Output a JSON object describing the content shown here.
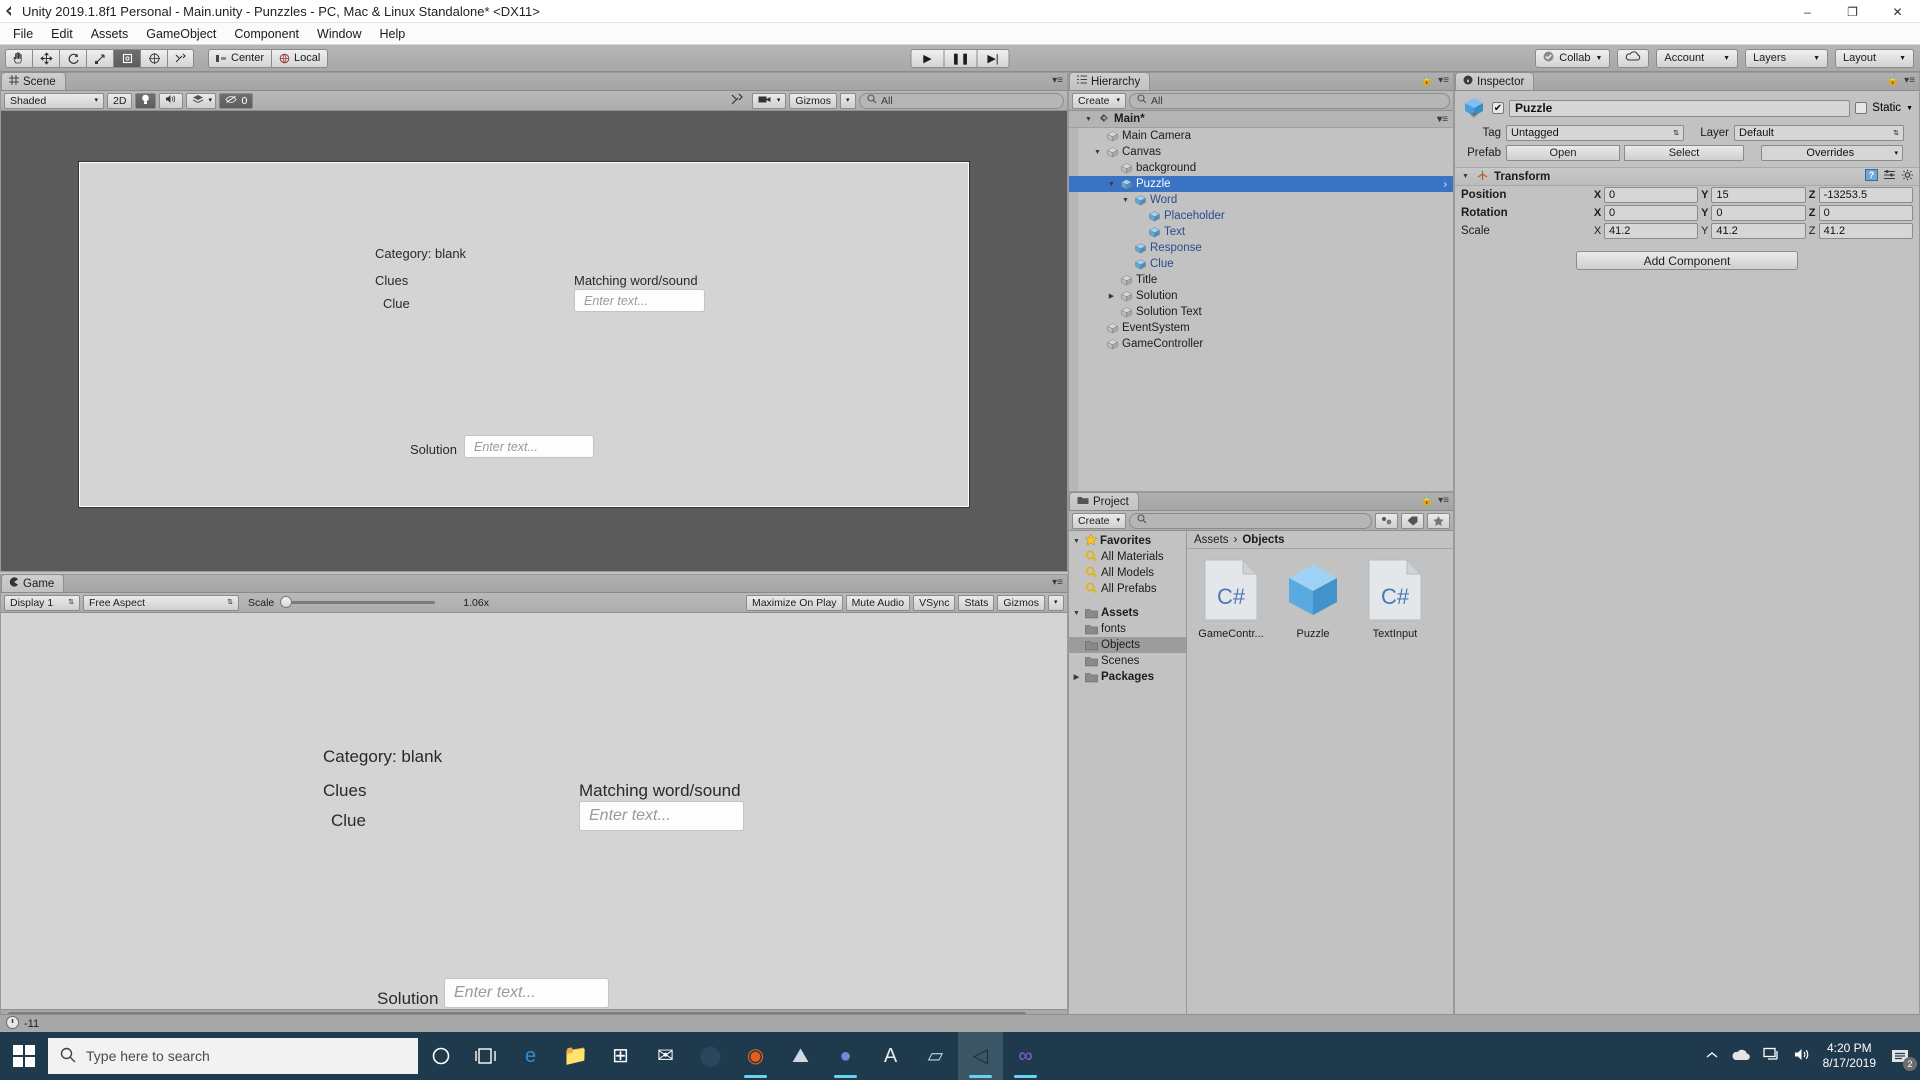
{
  "window": {
    "title": "Unity 2019.1.8f1 Personal - Main.unity - Punzzles - PC, Mac & Linux Standalone* <DX11>",
    "minimize": "–",
    "maximize": "❐",
    "close": "✕"
  },
  "menu": [
    "File",
    "Edit",
    "Assets",
    "GameObject",
    "Component",
    "Window",
    "Help"
  ],
  "toolbar": {
    "tools": [
      "hand-tool",
      "move-tool",
      "rotate-tool",
      "scale-tool",
      "rect-tool",
      "transform-tool",
      "custom-tool"
    ],
    "active_tool_index": 4,
    "pivot_label": "Center",
    "space_label": "Local",
    "play": "▶",
    "pause": "❚❚",
    "step": "▶|",
    "collab_label": "Collab",
    "account_label": "Account",
    "layers_label": "Layers",
    "layout_label": "Layout"
  },
  "scene": {
    "tab_label": "Scene",
    "draw_mode": "Shaded",
    "mode_2d": "2D",
    "lighting_icon": "light-bulb-icon",
    "audio_icon": "speaker-icon",
    "fx_icon": "effects-icon",
    "hidden_count": "0",
    "gizmos_label": "Gizmos",
    "search_placeholder": "All",
    "camera_icon": "camera-icon",
    "tools_icon": "tools-icon"
  },
  "game": {
    "tab_label": "Game",
    "display": "Display 1",
    "aspect": "Free Aspect",
    "scale_label": "Scale",
    "scale_value": "1.06x",
    "maximize_label": "Maximize On Play",
    "mute_label": "Mute Audio",
    "vsync_label": "VSync",
    "stats_label": "Stats",
    "gizmos_label": "Gizmos"
  },
  "puzzle_ui": {
    "category": "Category: blank",
    "clues_header": "Clues",
    "matching_header": "Matching word/sound",
    "clue_label": "Clue",
    "clue_placeholder": "Enter text...",
    "solution_label": "Solution",
    "solution_placeholder": "Enter text..."
  },
  "hierarchy": {
    "tab_label": "Hierarchy",
    "create_label": "Create",
    "search_placeholder": "All",
    "scene_name": "Main*",
    "items": [
      {
        "label": "Main Camera",
        "depth": 1,
        "twisty": "",
        "prefab": false,
        "selected": false
      },
      {
        "label": "Canvas",
        "depth": 1,
        "twisty": "down",
        "prefab": false,
        "selected": false
      },
      {
        "label": "background",
        "depth": 2,
        "twisty": "",
        "prefab": false,
        "selected": false
      },
      {
        "label": "Puzzle",
        "depth": 2,
        "twisty": "down",
        "prefab": true,
        "selected": true
      },
      {
        "label": "Word",
        "depth": 3,
        "twisty": "down",
        "prefab": true,
        "selected": false
      },
      {
        "label": "Placeholder",
        "depth": 4,
        "twisty": "",
        "prefab": true,
        "selected": false
      },
      {
        "label": "Text",
        "depth": 4,
        "twisty": "",
        "prefab": true,
        "selected": false
      },
      {
        "label": "Response",
        "depth": 3,
        "twisty": "",
        "prefab": true,
        "selected": false
      },
      {
        "label": "Clue",
        "depth": 3,
        "twisty": "",
        "prefab": true,
        "selected": false
      },
      {
        "label": "Title",
        "depth": 2,
        "twisty": "",
        "prefab": false,
        "selected": false
      },
      {
        "label": "Solution",
        "depth": 2,
        "twisty": "right",
        "prefab": false,
        "selected": false
      },
      {
        "label": "Solution Text",
        "depth": 2,
        "twisty": "",
        "prefab": false,
        "selected": false
      },
      {
        "label": "EventSystem",
        "depth": 1,
        "twisty": "",
        "prefab": false,
        "selected": false
      },
      {
        "label": "GameController",
        "depth": 1,
        "twisty": "",
        "prefab": false,
        "selected": false
      }
    ]
  },
  "inspector": {
    "tab_label": "Inspector",
    "object_name": "Puzzle",
    "enabled": true,
    "static_label": "Static",
    "tag_label": "Tag",
    "tag_value": "Untagged",
    "layer_label": "Layer",
    "layer_value": "Default",
    "prefab_label": "Prefab",
    "open_label": "Open",
    "select_label": "Select",
    "overrides_label": "Overrides",
    "transform": {
      "title": "Transform",
      "position_label": "Position",
      "rotation_label": "Rotation",
      "scale_label": "Scale",
      "position": {
        "x": "0",
        "y": "15",
        "z": "-13253.5"
      },
      "rotation": {
        "x": "0",
        "y": "0",
        "z": "0"
      },
      "scale": {
        "x": "41.2",
        "y": "41.2",
        "z": "41.2"
      },
      "axes": [
        "X",
        "Y",
        "Z"
      ]
    },
    "add_component_label": "Add Component"
  },
  "project": {
    "tab_label": "Project",
    "create_label": "Create",
    "search_placeholder": "",
    "favorites_label": "Favorites",
    "favorites": [
      "All Materials",
      "All Models",
      "All Prefabs"
    ],
    "assets_label": "Assets",
    "folders": [
      {
        "label": "fonts",
        "selected": false
      },
      {
        "label": "Objects",
        "selected": true
      },
      {
        "label": "Scenes",
        "selected": false
      }
    ],
    "packages_label": "Packages",
    "breadcrumb": [
      "Assets",
      "Objects"
    ],
    "assets": [
      {
        "label": "GameContr...",
        "icon": "csharp-script-icon"
      },
      {
        "label": "Puzzle",
        "icon": "prefab-cube-icon"
      },
      {
        "label": "TextInput",
        "icon": "csharp-script-icon"
      }
    ]
  },
  "statusbar": {
    "message": "-11",
    "icon": "warning-icon"
  },
  "taskbar": {
    "search_placeholder": "Type here to search",
    "start_icon": "windows-logo-icon",
    "cortana_icon": "cortana-circle-icon",
    "taskview_icon": "task-view-icon",
    "apps": [
      {
        "name": "edge-icon",
        "glyph": "e",
        "color": "#2e8dd8",
        "running": false
      },
      {
        "name": "file-explorer-icon",
        "glyph": "📁",
        "color": "#f5c242",
        "running": false
      },
      {
        "name": "microsoft-store-icon",
        "glyph": "⊞",
        "color": "#ffffff",
        "running": false
      },
      {
        "name": "mail-icon",
        "glyph": "✉",
        "color": "#ffffff",
        "running": false
      },
      {
        "name": "steam-icon",
        "glyph": "⬤",
        "color": "#2a475e",
        "running": false
      },
      {
        "name": "firefox-icon",
        "glyph": "◉",
        "color": "#e85d1b",
        "running": true
      },
      {
        "name": "photos-icon",
        "glyph": "⛰",
        "color": "#cfd8e3",
        "running": false
      },
      {
        "name": "discord-icon",
        "glyph": "●",
        "color": "#7289da",
        "running": true
      },
      {
        "name": "acrobat-icon",
        "glyph": "A",
        "color": "#e8e8e8",
        "running": false
      },
      {
        "name": "notes-icon",
        "glyph": "▱",
        "color": "#bcd7ea",
        "running": false
      },
      {
        "name": "unity-icon",
        "glyph": "◁",
        "color": "#222c37",
        "running": true,
        "active": true
      },
      {
        "name": "visual-studio-icon",
        "glyph": "∞",
        "color": "#8a62d0",
        "running": true
      }
    ],
    "tray": {
      "chevron": "⌃",
      "onedrive": "onedrive-icon",
      "network": "network-icon",
      "volume": "volume-icon"
    },
    "time": "4:20 PM",
    "date": "8/17/2019",
    "notification_count": "2"
  }
}
